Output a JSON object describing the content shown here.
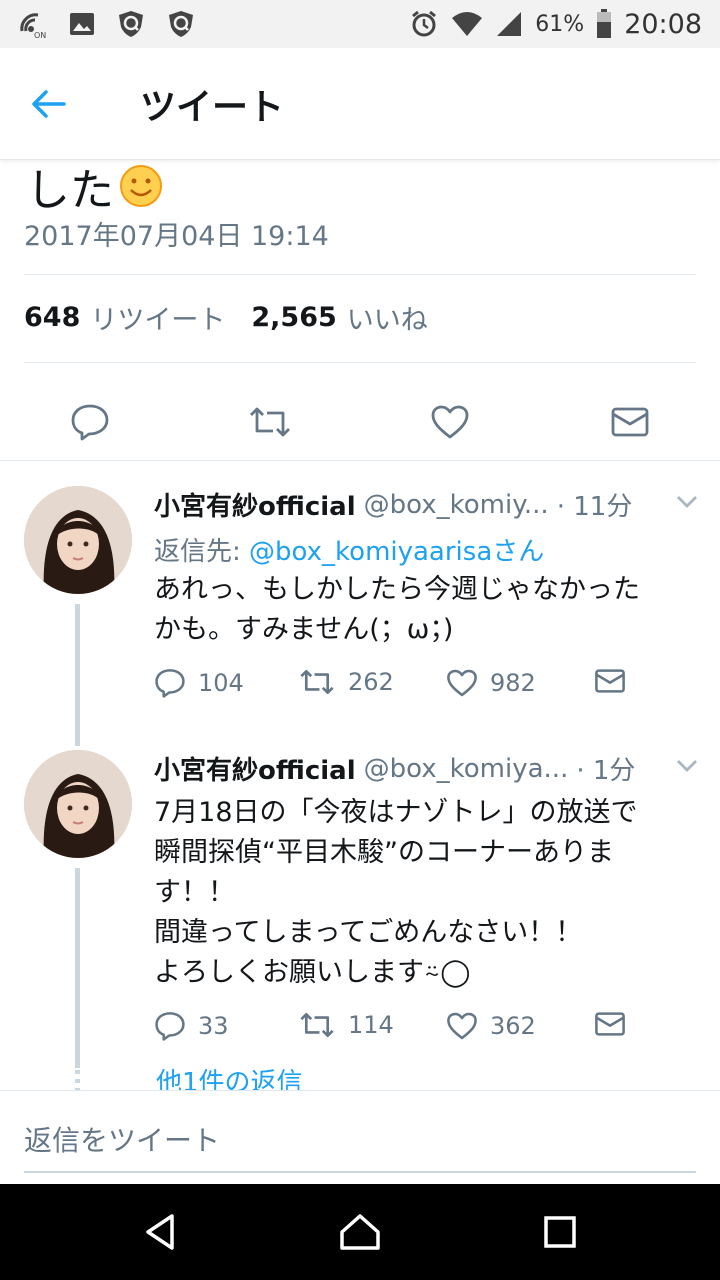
{
  "status_bar": {
    "battery": "61%",
    "time": "20:08",
    "icons": [
      "nfc-icon",
      "image-icon",
      "shield-icon",
      "shield-icon",
      "alarm-icon",
      "wifi-icon",
      "signal-icon",
      "battery-icon"
    ]
  },
  "header": {
    "title": "ツイート",
    "back_icon": "back-arrow-icon"
  },
  "tweet": {
    "text_tail": "した",
    "timestamp": "2017年07月04日 19:14",
    "retweet_count": "648",
    "retweet_label": "リツイート",
    "like_count": "2,565",
    "like_label": "いいね",
    "action_icons": [
      "reply-icon",
      "retweet-icon",
      "like-icon",
      "dm-icon"
    ]
  },
  "replies": [
    {
      "name": "小宮有紗official",
      "handle": "@box_komiy...",
      "time": "· 11分",
      "reply_to_prefix": "返信先: ",
      "reply_to_user": "@box_komiyaarisaさん",
      "text_lines": [
        "あれっ、もしかしたら今週じゃなかった",
        "かも。すみません(；ω；)"
      ],
      "replies": "104",
      "retweets": "262",
      "likes": "982"
    },
    {
      "name": "小宮有紗official",
      "handle": "@box_komiya...",
      "time": "· 1分",
      "text_lines": [
        "7月18日の「今夜はナゾトレ」の放送で",
        "瞬間探偵“平目木駿”のコーナーありま",
        "す！！",
        "間違ってしまってごめんなさい！！",
        "よろしくお願いします⍨◯"
      ],
      "replies": "33",
      "retweets": "114",
      "likes": "362"
    }
  ],
  "more_replies": "他1件の返信",
  "compose": {
    "placeholder": "返信をツイート"
  },
  "nav": {
    "icons": [
      "back-triangle-icon",
      "home-icon",
      "recents-square-icon"
    ]
  },
  "colors": {
    "accent": "#1da1f2",
    "text": "#14171a",
    "secondary": "#657786",
    "divider": "#e1e8ed"
  }
}
